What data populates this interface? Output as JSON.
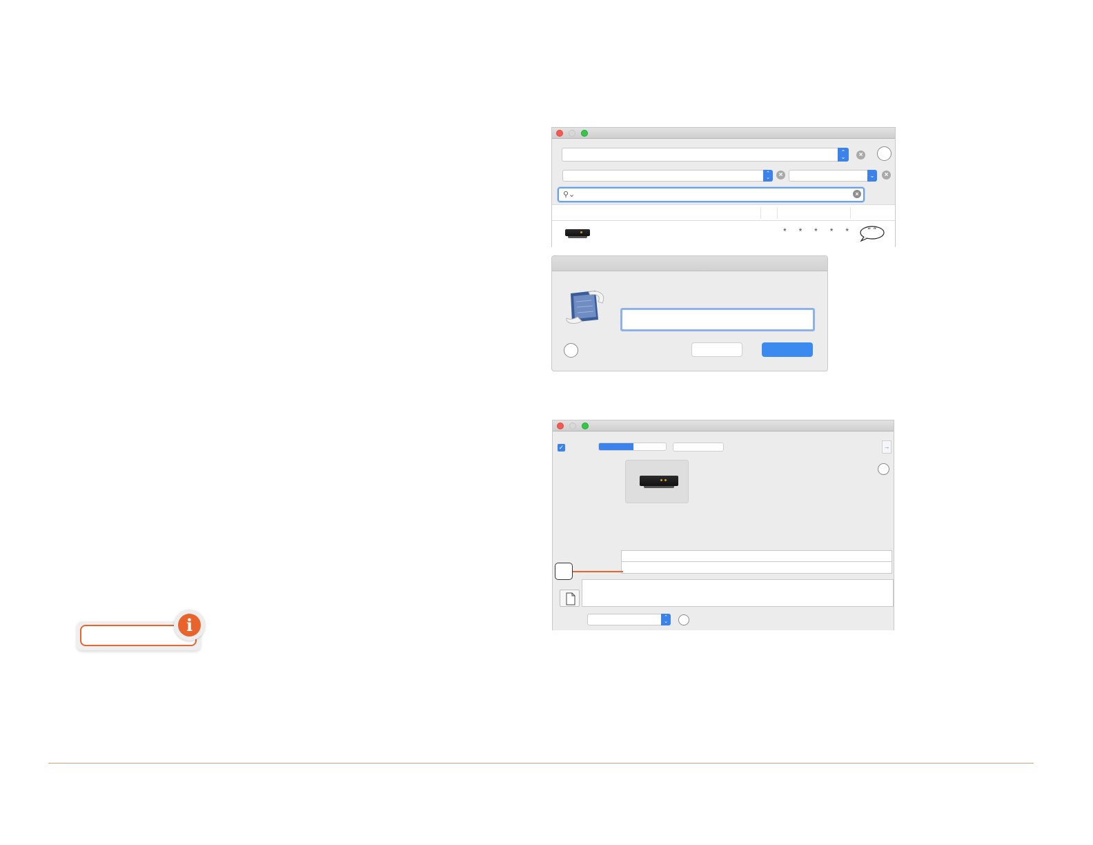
{
  "colors": {
    "accent": "#3b82ea",
    "brand_orange": "#e8642c",
    "window_bg": "#ececec",
    "traffic_red": "#f25a52",
    "traffic_green": "#35c748"
  },
  "search_window": {
    "icons": [
      "close-icon",
      "minimize-icon",
      "zoom-icon",
      "popup-arrows-icon",
      "clear-icon",
      "help-icon",
      "search-icon",
      "chevron-down-icon",
      "product-image",
      "quote-icon"
    ],
    "rating_glyphs": [
      "*",
      "*",
      "*",
      "*",
      "*"
    ],
    "quote_glyph": "“ ”"
  },
  "sheet": {
    "icons": [
      "document-scroll-icon",
      "help-icon"
    ]
  },
  "detail_window": {
    "icons": [
      "checkbox-icon",
      "sidebar-toggle-icon",
      "help-icon",
      "product-image",
      "document-icon",
      "popup-arrows-icon"
    ]
  },
  "info_badge": {
    "icon": "info-icon",
    "glyph": "i"
  }
}
